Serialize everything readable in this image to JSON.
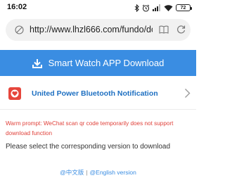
{
  "status_bar": {
    "time": "16:02",
    "battery_level": "72",
    "icons": [
      "bluetooth-icon",
      "alarm-icon",
      "signal-icon",
      "wifi-icon",
      "battery-icon"
    ]
  },
  "browser": {
    "url": "http://www.lhzl666.com/fundo/dc",
    "icons": [
      "site-info-icon",
      "reader-mode-icon",
      "refresh-icon"
    ]
  },
  "download_banner": {
    "label": "Smart Watch APP Download",
    "icon": "download-icon",
    "background_color": "#3a8de2"
  },
  "app": {
    "name": "United Power Bluetooth Notification",
    "logo_color": "#e6463c",
    "name_color": "#1d6fc1"
  },
  "messages": {
    "warning": "Warm prompt: WeChat scan qr code temporarily does not support download function",
    "warning_color": "#e0413a",
    "instruction": "Please select the corresponding version to download"
  },
  "language_links": {
    "chinese": "@中文版",
    "separator": "|",
    "english": "@English version"
  }
}
